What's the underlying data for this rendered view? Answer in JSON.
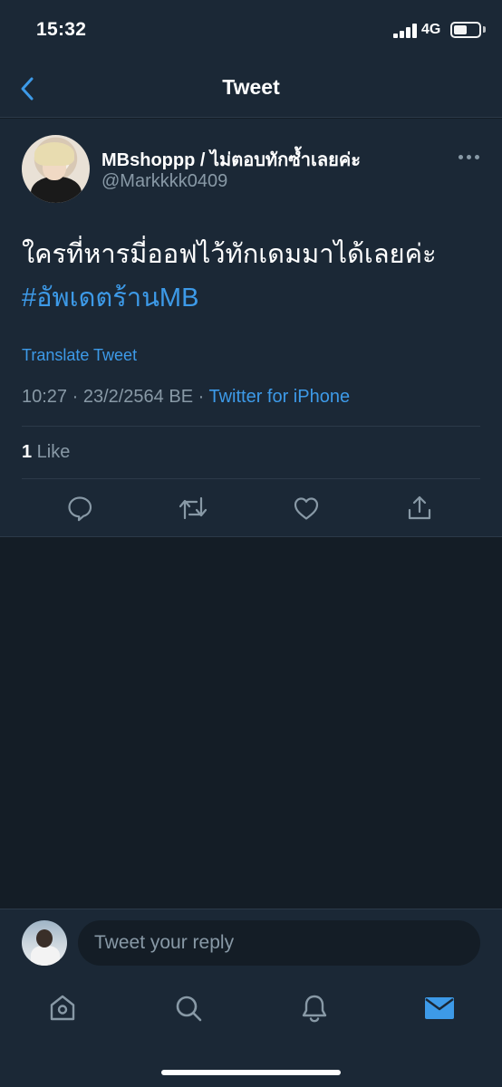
{
  "status_bar": {
    "time": "15:32",
    "network": "4G",
    "signal_bars": 4,
    "battery_level": 0.55
  },
  "header": {
    "title": "Tweet",
    "back_icon": "chevron-left-icon"
  },
  "tweet": {
    "display_name": "MBshoppp / ไม่ตอบทักซ้ำเลยค่ะ",
    "handle": "@Markkkk0409",
    "text": "ใครที่หารมี่ออฟไว้ทักเดมมาได้เลยค่ะ",
    "hashtag": "#อัพเดตร้านMB",
    "translate_label": "Translate Tweet",
    "timestamp": "10:27 · 23/2/2564 BE · ",
    "source": "Twitter for iPhone",
    "likes_count": "1",
    "likes_label": " Like",
    "more_icon": "more-horizontal-icon",
    "actions": [
      {
        "name": "reply",
        "icon": "comment-icon"
      },
      {
        "name": "retweet",
        "icon": "retweet-icon"
      },
      {
        "name": "like",
        "icon": "heart-icon"
      },
      {
        "name": "share",
        "icon": "share-icon"
      }
    ]
  },
  "reply_bar": {
    "placeholder": "Tweet your reply"
  },
  "tab_bar": {
    "tabs": [
      {
        "name": "home",
        "icon": "home-icon",
        "active": false
      },
      {
        "name": "search",
        "icon": "search-icon",
        "active": false
      },
      {
        "name": "notifications",
        "icon": "bell-icon",
        "active": false
      },
      {
        "name": "messages",
        "icon": "mail-icon",
        "active": true
      }
    ]
  },
  "colors": {
    "background": "#141d26",
    "surface": "#1b2836",
    "accent": "#3d9ae8",
    "secondary_text": "#8899a6",
    "divider": "#2c3a49"
  }
}
